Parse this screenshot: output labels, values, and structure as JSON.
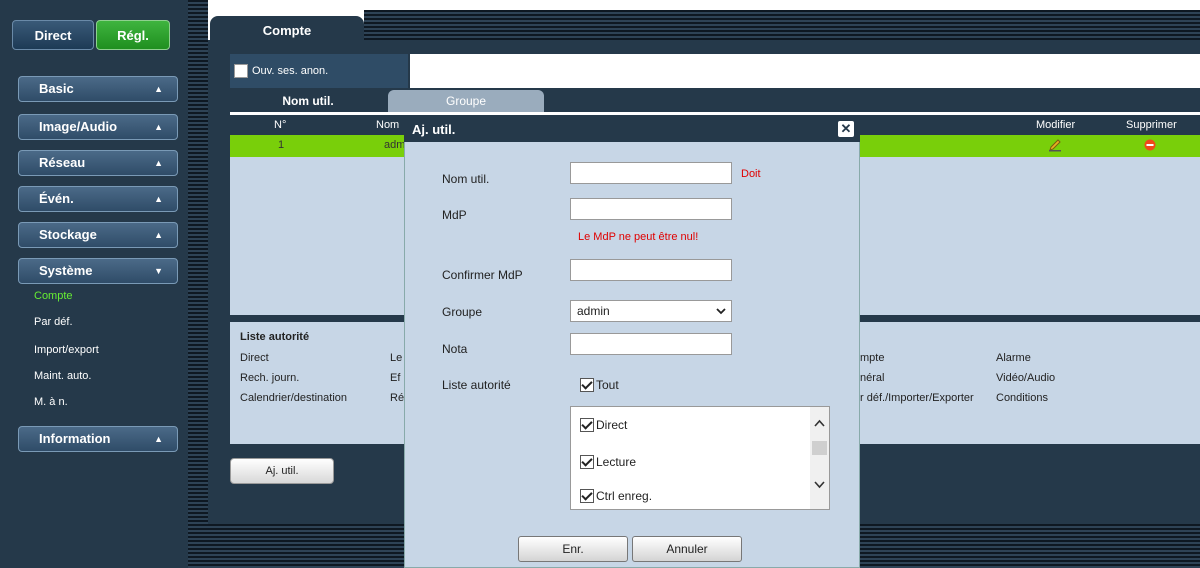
{
  "topbar": {
    "direct_label": "Direct",
    "regl_label": "Régl."
  },
  "sidebar": {
    "menus": [
      {
        "label": "Basic"
      },
      {
        "label": "Image/Audio"
      },
      {
        "label": "Réseau"
      },
      {
        "label": "Évén."
      },
      {
        "label": "Stockage"
      },
      {
        "label": "Système"
      },
      {
        "label": "Information"
      }
    ],
    "sub_items": [
      "Compte",
      "Par déf.",
      "Import/export",
      "Maint. auto.",
      "M. à n."
    ],
    "active_sub": "Compte"
  },
  "main": {
    "tab_label": "Compte",
    "anon_label": "Ouv. ses. anon.",
    "subtabs": [
      "Nom util.",
      "Groupe"
    ],
    "table": {
      "headers": {
        "num": "N°",
        "name": "Nom",
        "modify": "Modifier",
        "delete": "Supprimer"
      },
      "row": {
        "num": "1",
        "name": "adm"
      }
    },
    "perm_title": "Liste autorité",
    "perm_col1": [
      "Direct",
      "Rech. journ.",
      "Calendrier/destination"
    ],
    "perm_col2": [
      "Le",
      "Ef",
      "Ré"
    ],
    "perm_col3": [
      "mpte",
      "néral",
      "r déf./Importer/Exporter"
    ],
    "perm_col4": [
      "Alarme",
      "Vidéo/Audio",
      "Conditions"
    ],
    "add_user_label": "Aj. util."
  },
  "modal": {
    "title": "Aj. util.",
    "username_label": "Nom util.",
    "required_text": "Doit",
    "password_label": "MdP",
    "password_error": "Le MdP ne peut être nul!",
    "confirm_label": "Confirmer MdP",
    "group_label": "Groupe",
    "group_value": "admin",
    "note_label": "Nota",
    "perm_label": "Liste autorité",
    "all_label": "Tout",
    "perm_items": [
      "Direct",
      "Lecture",
      "Ctrl enreg."
    ],
    "save_label": "Enr.",
    "cancel_label": "Annuler"
  },
  "colors": {
    "sidebar_bg": "#25394a",
    "active_green": "#66ee33",
    "row_selected": "#79cf0a",
    "panel_light": "#c7d6e6",
    "error_red": "#e00000"
  }
}
